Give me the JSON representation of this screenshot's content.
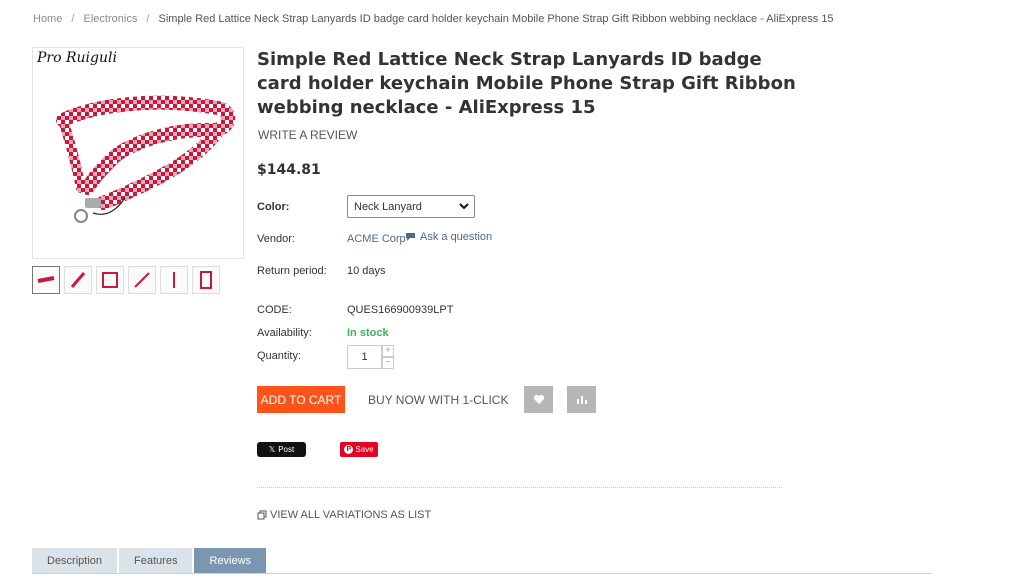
{
  "breadcrumb": {
    "home": "Home",
    "category": "Electronics",
    "current": "Simple Red Lattice Neck Strap Lanyards ID badge card holder keychain Mobile Phone Strap Gift Ribbon webbing necklace - AliExpress 15",
    "separator": "/"
  },
  "gallery": {
    "brand_mark": "Pro Ruiguli",
    "thumbnail_count": 6
  },
  "product": {
    "title": "Simple Red Lattice Neck Strap Lanyards ID badge card holder keychain Mobile Phone Strap Gift Ribbon webbing necklace - AliExpress 15",
    "write_review": "WRITE A REVIEW",
    "price": "$144.81",
    "color_label": "Color:",
    "color_value": "Neck Lanyard",
    "vendor_label": "Vendor:",
    "vendor_value": "ACME Corp",
    "ask_question": "Ask a question",
    "return_label": "Return period:",
    "return_value": "10 days",
    "code_label": "CODE:",
    "code_value": "QUES166900939LPT",
    "availability_label": "Availability:",
    "availability_value": "In stock",
    "quantity_label": "Quantity:",
    "quantity_value": "1"
  },
  "actions": {
    "add_to_cart": "ADD TO CART",
    "buy_now": "BUY NOW WITH 1-CLICK",
    "wishlist_icon": "heart-icon",
    "compare_icon": "chart-icon"
  },
  "social": {
    "tweet": "Post",
    "pin_save": "Save"
  },
  "variations": "VIEW ALL VARIATIONS AS LIST",
  "tabs": [
    {
      "label": "Description"
    },
    {
      "label": "Features"
    },
    {
      "label": "Reviews"
    }
  ],
  "colors": {
    "accent": "#ff5319",
    "in_stock": "#3bb35b",
    "tab_active": "#7a96b0",
    "tab_inactive": "#dbe3ea",
    "lanyard_red": "#c8193c"
  }
}
